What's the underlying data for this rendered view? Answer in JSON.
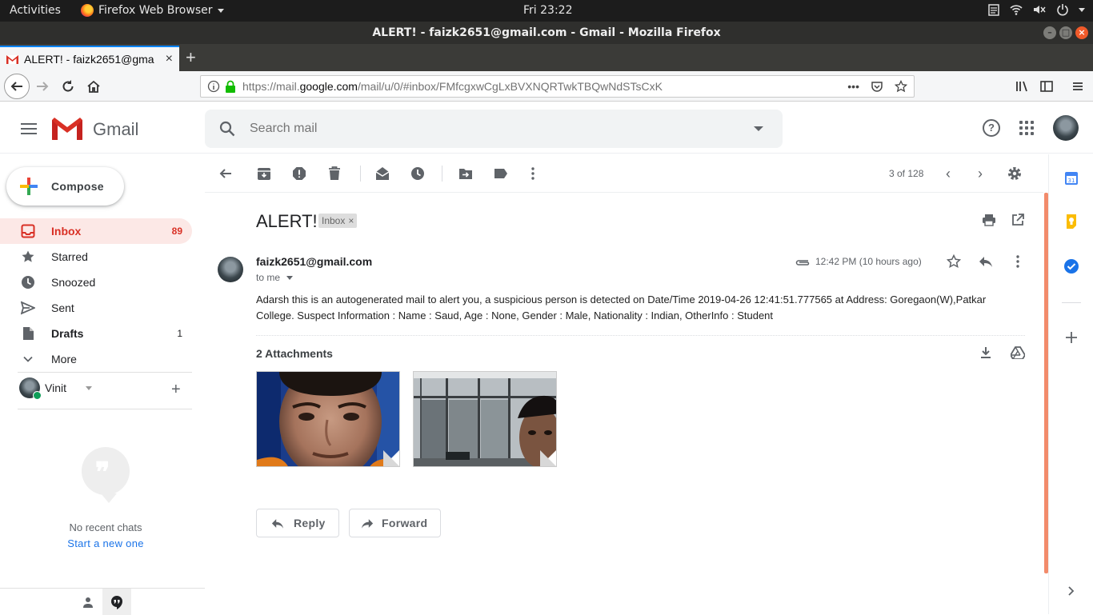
{
  "os": {
    "activities": "Activities",
    "app_menu": "Firefox Web Browser",
    "clock": "Fri 23:22"
  },
  "browser": {
    "window_title": "ALERT! - faizk2651@gmail.com - Gmail - Mozilla Firefox",
    "tab_title": "ALERT! - faizk2651@gma",
    "url_prefix": "https://mail.",
    "url_host": "google.com",
    "url_path": "/mail/u/0/#inbox/FMfcgxwCgLxBVXNQRTwkTBQwNdSTsCxK"
  },
  "gmail": {
    "brand": "Gmail",
    "search_placeholder": "Search mail",
    "compose_label": "Compose",
    "colors": {
      "accent_red": "#d93025",
      "active_bg": "#fce8e6",
      "link_blue": "#1a73e8",
      "scroll_accent": "#f28b6b"
    }
  },
  "sidebar": {
    "items": [
      {
        "label": "Inbox",
        "count": "89",
        "icon": "inbox-icon"
      },
      {
        "label": "Starred",
        "count": "",
        "icon": "star-icon"
      },
      {
        "label": "Snoozed",
        "count": "",
        "icon": "clock-icon"
      },
      {
        "label": "Sent",
        "count": "",
        "icon": "send-icon"
      },
      {
        "label": "Drafts",
        "count": "1",
        "icon": "draft-icon"
      },
      {
        "label": "More",
        "count": "",
        "icon": "chevron-down-icon"
      }
    ],
    "hangouts_user": "Vinit",
    "no_recent_chats": "No recent chats",
    "start_new": "Start a new one"
  },
  "toolbar": {
    "pager": "3 of 128"
  },
  "message": {
    "subject": "ALERT!",
    "label": "Inbox",
    "sender": "faizk2651@gmail.com",
    "to": "to me",
    "time": "12:42 PM (10 hours ago)",
    "body_line1": "Adarsh this is an autogenerated mail to alert you, a suspicious person is detected on Date/Time 2019-04-26 12:41:51.777565 at Address: Goregaon(W),Patkar",
    "body_line2": "College. Suspect Information : Name : Saud, Age : None, Gender : Male, Nationality : Indian, OtherInfo : Student",
    "attachments_title": "2 Attachments",
    "reply_label": "Reply",
    "forward_label": "Forward"
  }
}
